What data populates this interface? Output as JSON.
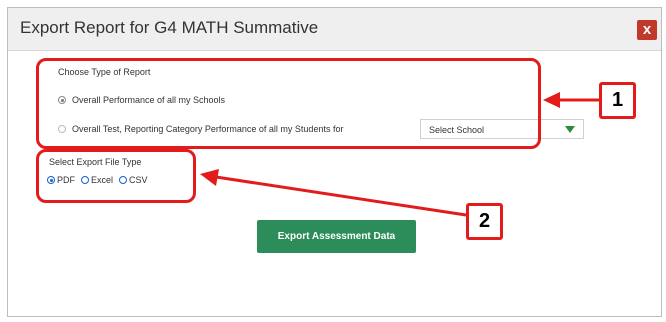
{
  "dialog": {
    "title": "Export Report for G4 MATH Summative",
    "close_label": "x"
  },
  "report_type": {
    "label": "Choose Type of Report",
    "options": [
      {
        "label": "Overall Performance of all my Schools",
        "selected": true
      },
      {
        "label": "Overall Test, Reporting Category Performance of all my Students for",
        "selected": false
      }
    ],
    "school_select": {
      "value": "Select School"
    }
  },
  "file_type": {
    "label": "Select Export File Type",
    "options": [
      {
        "label": "PDF",
        "selected": true
      },
      {
        "label": "Excel",
        "selected": false
      },
      {
        "label": "CSV",
        "selected": false
      }
    ]
  },
  "export_button": {
    "label": "Export Assessment Data"
  },
  "callouts": {
    "one": "1",
    "two": "2"
  },
  "colors": {
    "highlight": "#e31b1b",
    "export_button": "#2c8c5a",
    "close_button": "#c0392b"
  }
}
